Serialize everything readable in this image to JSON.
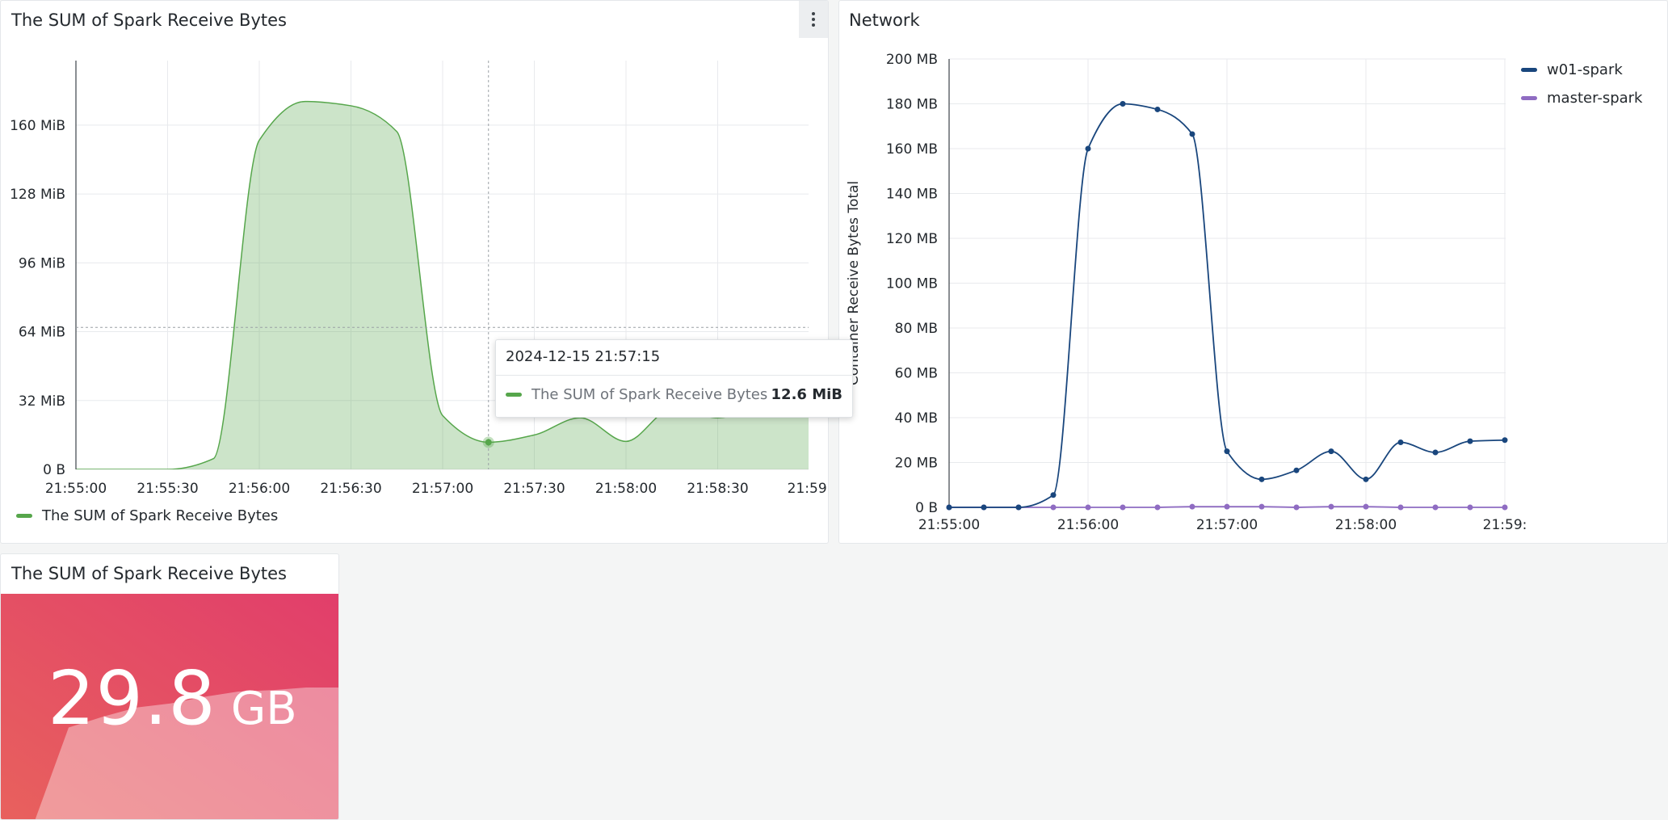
{
  "panels": {
    "area": {
      "title": "The SUM of Spark Receive Bytes",
      "menu_icon": "kebab-menu-icon",
      "legend": [
        {
          "label": "The SUM of Spark Receive Bytes",
          "color": "#56a64b"
        }
      ],
      "tooltip": {
        "time": "2024-12-15 21:57:15",
        "series": "The SUM of Spark Receive Bytes",
        "value": "12.6 MiB",
        "color": "#56a64b"
      }
    },
    "network": {
      "title": "Network",
      "legend": [
        {
          "label": "w01-spark",
          "color": "#19467d"
        },
        {
          "label": "master-spark",
          "color": "#8f6cc2"
        }
      ]
    },
    "stat": {
      "title": "The SUM of Spark Receive Bytes",
      "value": "29.8",
      "unit": "GB",
      "gradient": [
        "#e8615d",
        "#e13e6b"
      ]
    }
  },
  "chart_data": [
    {
      "type": "area",
      "title": "The SUM of Spark Receive Bytes",
      "x_unit": "time",
      "x_ticks": [
        "21:55:00",
        "21:55:30",
        "21:56:00",
        "21:56:30",
        "21:57:00",
        "21:57:30",
        "21:58:00",
        "21:58:30",
        "21:59:"
      ],
      "y_unit": "MiB",
      "y_ticks": [
        "0 B",
        "32 MiB",
        "64 MiB",
        "96 MiB",
        "128 MiB",
        "160 MiB"
      ],
      "ylim": [
        0,
        190
      ],
      "xlim": [
        "21:55:00",
        "21:59:00"
      ],
      "grid": true,
      "legend_position": "bottom",
      "crosshair": {
        "x": "21:57:15",
        "y": 66
      },
      "series": [
        {
          "name": "The SUM of Spark Receive Bytes",
          "color": "#56a64b",
          "points": [
            {
              "x": "21:55:00",
              "y": 0
            },
            {
              "x": "21:55:30",
              "y": 0
            },
            {
              "x": "21:55:45",
              "y": 5
            },
            {
              "x": "21:56:00",
              "y": 153
            },
            {
              "x": "21:56:15",
              "y": 171
            },
            {
              "x": "21:56:30",
              "y": 169
            },
            {
              "x": "21:56:45",
              "y": 157
            },
            {
              "x": "21:57:00",
              "y": 25
            },
            {
              "x": "21:57:15",
              "y": 12.6
            },
            {
              "x": "21:57:30",
              "y": 16
            },
            {
              "x": "21:57:45",
              "y": 24
            },
            {
              "x": "21:58:00",
              "y": 13
            },
            {
              "x": "21:58:15",
              "y": 28
            },
            {
              "x": "21:58:30",
              "y": 24
            },
            {
              "x": "21:58:45",
              "y": 28
            },
            {
              "x": "21:59:00",
              "y": 28
            }
          ]
        }
      ]
    },
    {
      "type": "line",
      "title": "Network",
      "ylabel": "Container Receive Bytes Total",
      "x_ticks": [
        "21:55:00",
        "21:56:00",
        "21:57:00",
        "21:58:00",
        "21:59:"
      ],
      "y_unit": "MB",
      "y_ticks": [
        "0 B",
        "20 MB",
        "40 MB",
        "60 MB",
        "80 MB",
        "100 MB",
        "120 MB",
        "140 MB",
        "160 MB",
        "180 MB",
        "200 MB"
      ],
      "ylim": [
        0,
        200
      ],
      "xlim": [
        "21:55:00",
        "21:59:00"
      ],
      "grid": true,
      "legend_position": "top-right",
      "series": [
        {
          "name": "w01-spark",
          "color": "#19467d",
          "points": [
            {
              "x": "21:55:00",
              "y": 0
            },
            {
              "x": "21:55:15",
              "y": 0
            },
            {
              "x": "21:55:30",
              "y": 0
            },
            {
              "x": "21:55:45",
              "y": 5.5
            },
            {
              "x": "21:56:00",
              "y": 160
            },
            {
              "x": "21:56:15",
              "y": 180
            },
            {
              "x": "21:56:30",
              "y": 177.5
            },
            {
              "x": "21:56:45",
              "y": 166.5
            },
            {
              "x": "21:57:00",
              "y": 25
            },
            {
              "x": "21:57:15",
              "y": 12.5
            },
            {
              "x": "21:57:30",
              "y": 16.5
            },
            {
              "x": "21:57:45",
              "y": 25
            },
            {
              "x": "21:58:00",
              "y": 12.5
            },
            {
              "x": "21:58:15",
              "y": 29
            },
            {
              "x": "21:58:30",
              "y": 24.5
            },
            {
              "x": "21:58:45",
              "y": 29.5
            },
            {
              "x": "21:59:00",
              "y": 30
            }
          ]
        },
        {
          "name": "master-spark",
          "color": "#8f6cc2",
          "points": [
            {
              "x": "21:55:00",
              "y": 0
            },
            {
              "x": "21:55:15",
              "y": 0
            },
            {
              "x": "21:55:30",
              "y": 0
            },
            {
              "x": "21:55:45",
              "y": 0
            },
            {
              "x": "21:56:00",
              "y": 0
            },
            {
              "x": "21:56:15",
              "y": 0
            },
            {
              "x": "21:56:30",
              "y": 0
            },
            {
              "x": "21:56:45",
              "y": 0.3
            },
            {
              "x": "21:57:00",
              "y": 0.3
            },
            {
              "x": "21:57:15",
              "y": 0.3
            },
            {
              "x": "21:57:30",
              "y": 0
            },
            {
              "x": "21:57:45",
              "y": 0.3
            },
            {
              "x": "21:58:00",
              "y": 0.3
            },
            {
              "x": "21:58:15",
              "y": 0
            },
            {
              "x": "21:58:30",
              "y": 0
            },
            {
              "x": "21:58:45",
              "y": 0
            },
            {
              "x": "21:59:00",
              "y": 0
            }
          ]
        }
      ]
    },
    {
      "type": "stat",
      "title": "The SUM of Spark Receive Bytes",
      "value": 29.8,
      "unit": "GB",
      "sparkline": [
        0,
        0,
        70,
        78,
        85,
        88,
        93,
        97,
        98,
        100,
        100
      ]
    }
  ]
}
